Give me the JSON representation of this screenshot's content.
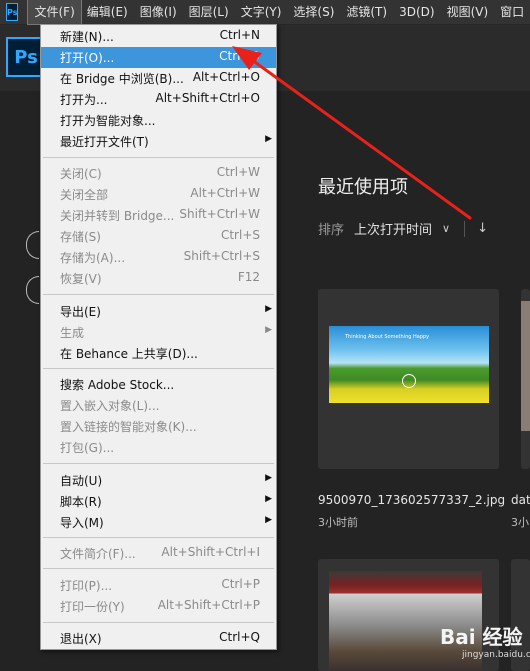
{
  "menubar": {
    "logo": "Ps",
    "items": [
      {
        "label": "文件(F)",
        "active": true
      },
      {
        "label": "编辑(E)"
      },
      {
        "label": "图像(I)"
      },
      {
        "label": "图层(L)"
      },
      {
        "label": "文字(Y)"
      },
      {
        "label": "选择(S)"
      },
      {
        "label": "滤镜(T)"
      },
      {
        "label": "3D(D)"
      },
      {
        "label": "视图(V)"
      },
      {
        "label": "窗口"
      }
    ]
  },
  "home": {
    "logo": "Ps",
    "recent_title": "最近使用项",
    "sort_label": "排序",
    "sort_value": "上次打开时间",
    "files": [
      {
        "name": "9500970_173602577337_2.jpg",
        "time": "3小时前"
      },
      {
        "name": "dat",
        "time": "3小"
      }
    ],
    "thumb_text": "Thinking About Something Happy"
  },
  "file_menu": {
    "items": [
      {
        "label": "新建(N)...",
        "shortcut": "Ctrl+N"
      },
      {
        "label": "打开(O)...",
        "shortcut": "Ctrl+O"
      },
      {
        "label": "在 Bridge 中浏览(B)...",
        "shortcut": "Alt+Ctrl+O"
      },
      {
        "label": "打开为...",
        "shortcut": "Alt+Shift+Ctrl+O"
      },
      {
        "label": "打开为智能对象...",
        "shortcut": ""
      },
      {
        "label": "最近打开文件(T)",
        "shortcut": ""
      },
      {
        "label": "关闭(C)",
        "shortcut": "Ctrl+W"
      },
      {
        "label": "关闭全部",
        "shortcut": "Alt+Ctrl+W"
      },
      {
        "label": "关闭并转到 Bridge...",
        "shortcut": "Shift+Ctrl+W"
      },
      {
        "label": "存储(S)",
        "shortcut": "Ctrl+S"
      },
      {
        "label": "存储为(A)...",
        "shortcut": "Shift+Ctrl+S"
      },
      {
        "label": "恢复(V)",
        "shortcut": "F12"
      },
      {
        "label": "导出(E)",
        "shortcut": ""
      },
      {
        "label": "生成",
        "shortcut": ""
      },
      {
        "label": "在 Behance 上共享(D)...",
        "shortcut": ""
      },
      {
        "label": "搜索 Adobe Stock...",
        "shortcut": ""
      },
      {
        "label": "置入嵌入对象(L)...",
        "shortcut": ""
      },
      {
        "label": "置入链接的智能对象(K)...",
        "shortcut": ""
      },
      {
        "label": "打包(G)...",
        "shortcut": ""
      },
      {
        "label": "自动(U)",
        "shortcut": ""
      },
      {
        "label": "脚本(R)",
        "shortcut": ""
      },
      {
        "label": "导入(M)",
        "shortcut": ""
      },
      {
        "label": "文件简介(F)...",
        "shortcut": "Alt+Shift+Ctrl+I"
      },
      {
        "label": "打印(P)...",
        "shortcut": "Ctrl+P"
      },
      {
        "label": "打印一份(Y)",
        "shortcut": "Alt+Shift+Ctrl+P"
      },
      {
        "label": "退出(X)",
        "shortcut": "Ctrl+Q"
      }
    ]
  },
  "watermark": {
    "main": "Bai 经验",
    "sub": "jingyan.baidu.com"
  },
  "colors": {
    "highlight": "#3d96dc",
    "annotation": "#e8221b",
    "ps_blue": "#31a8ff"
  }
}
